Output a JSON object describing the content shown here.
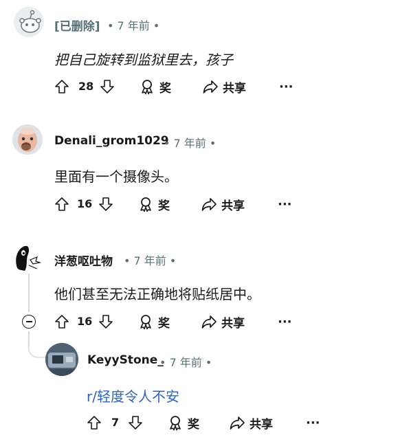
{
  "comments": [
    {
      "author": "[已删除]",
      "time": "• 7 年前 •",
      "body": "把自己旋转到监狱里去，孩子",
      "votes": "28",
      "award": "奖",
      "share": "共享",
      "more": "···"
    },
    {
      "author": "Denali_grom1029",
      "time": "• 7 年前 •",
      "body": "里面有一个摄像头。",
      "votes": "16",
      "award": "奖",
      "share": "共享",
      "more": "···"
    },
    {
      "author": "洋葱呕吐物",
      "time": "• 7 年前 •",
      "body": "他们甚至无法正确地将贴纸居中。",
      "votes": "16",
      "award": "奖",
      "share": "共享",
      "more": "···"
    },
    {
      "author": "KeyyStone_",
      "time": "• 7 年前 •",
      "body": "r/轻度令人不安",
      "votes": "7",
      "award": "奖",
      "share": "共享",
      "more": "···"
    }
  ],
  "colors": {
    "text": "#1a1a1b",
    "meta": "#576f76",
    "link": "#2a63c9",
    "thread": "#d6dadc"
  }
}
